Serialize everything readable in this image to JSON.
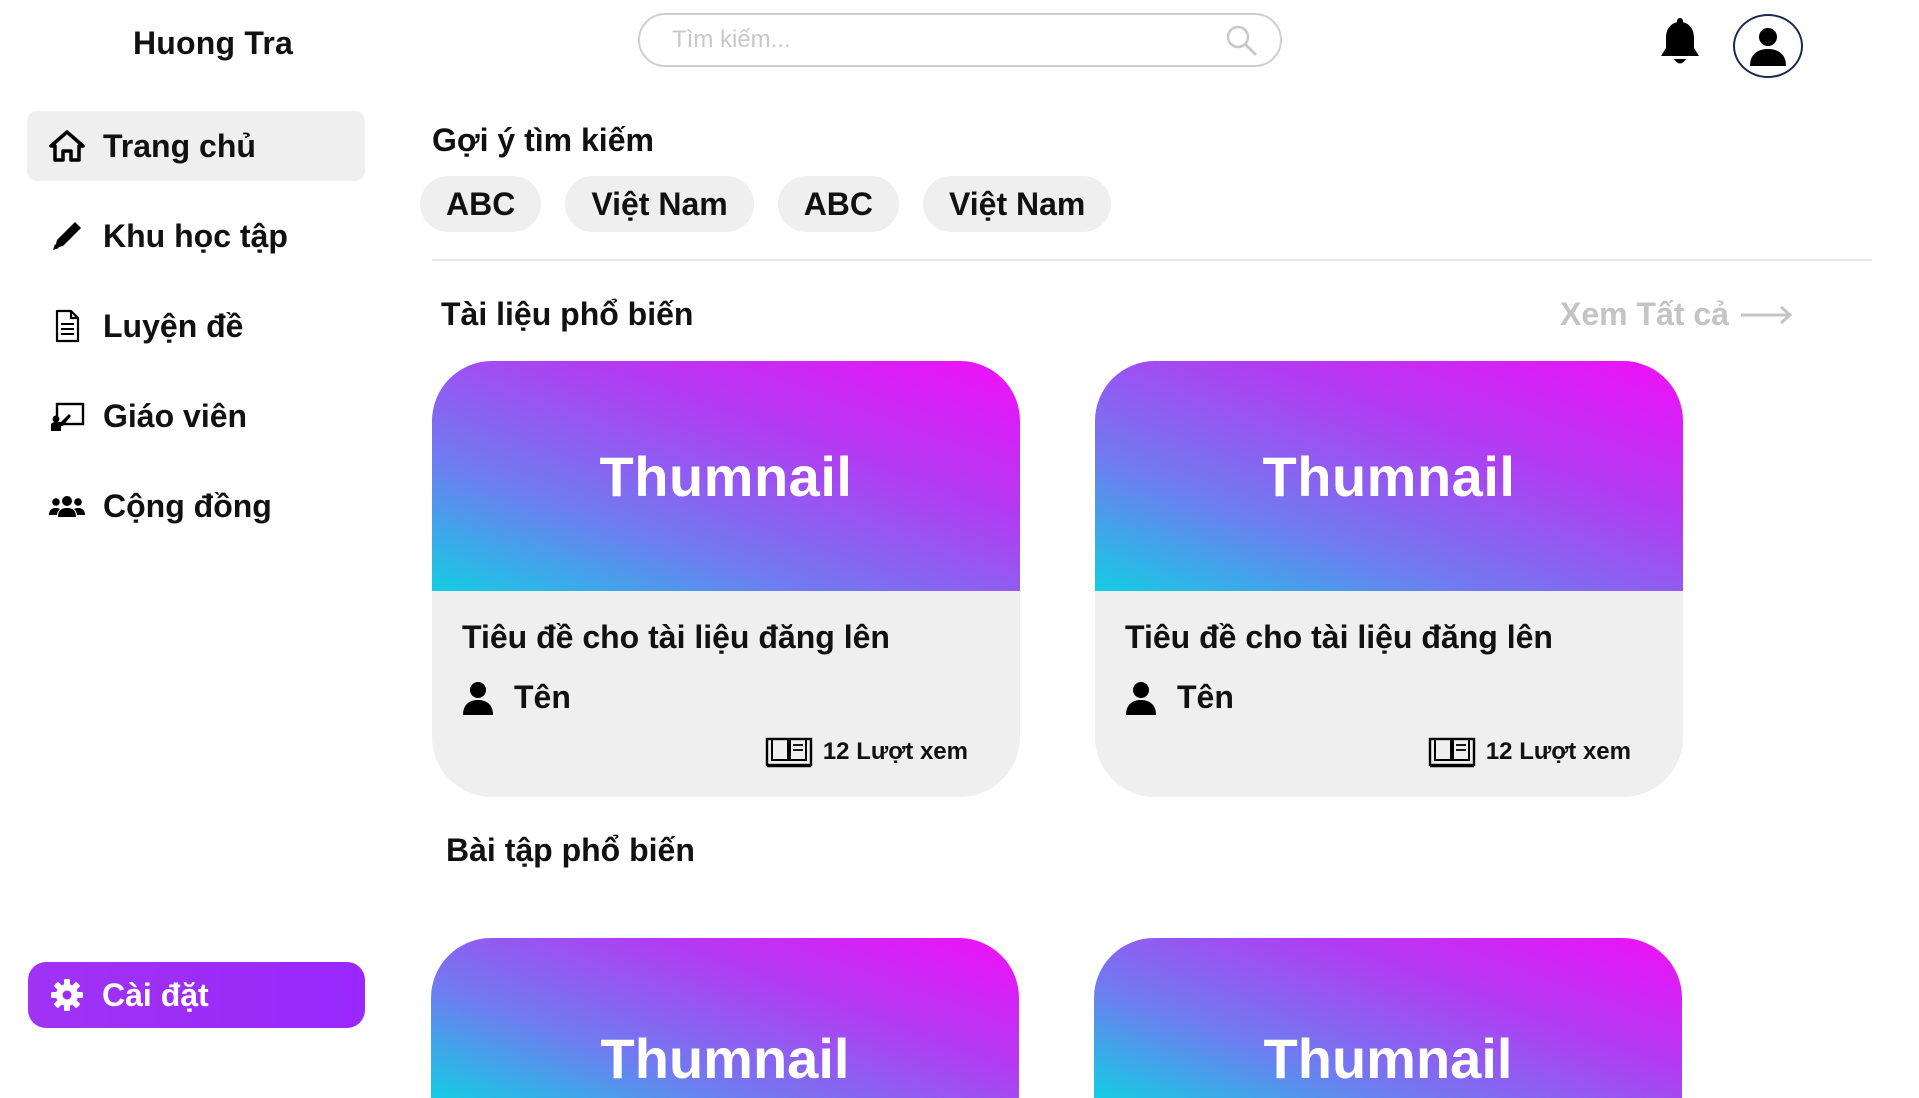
{
  "brand": "Huong Tra",
  "search": {
    "placeholder": "Tìm kiếm..."
  },
  "nav": [
    {
      "label": "Trang chủ",
      "icon": "home-icon",
      "active": true
    },
    {
      "label": "Khu học tập",
      "icon": "pencil-icon"
    },
    {
      "label": "Luyện đề",
      "icon": "document-icon"
    },
    {
      "label": "Giáo viên",
      "icon": "teacher-board-icon"
    },
    {
      "label": "Cộng đồng",
      "icon": "community-icon"
    }
  ],
  "settings": {
    "label": "Cài đặt",
    "icon": "gear-icon"
  },
  "suggestions": {
    "title": "Gợi ý tìm kiếm",
    "chips": [
      "ABC",
      "Việt Nam",
      "ABC",
      "Việt Nam"
    ]
  },
  "documents": {
    "title": "Tài liệu phổ biến",
    "see_all": "Xem Tất cả",
    "cards": [
      {
        "thumbnail": "Thumnail",
        "title": "Tiêu đề cho tài liệu đăng lên",
        "author": "Tên",
        "views": "12 Lượt xem"
      },
      {
        "thumbnail": "Thumnail",
        "title": "Tiêu đề cho tài liệu đăng lên",
        "author": "Tên",
        "views": "12 Lượt xem"
      }
    ]
  },
  "exercises": {
    "title": "Bài tập phổ biến",
    "cards": [
      {
        "thumbnail": "Thumnail"
      },
      {
        "thumbnail": "Thumnail"
      }
    ]
  },
  "colors": {
    "accent": "#9b2cf7",
    "thumb_gradient_start": "#f10ef9",
    "thumb_gradient_end": "#14cde3",
    "muted_text": "#c4c4c4"
  }
}
